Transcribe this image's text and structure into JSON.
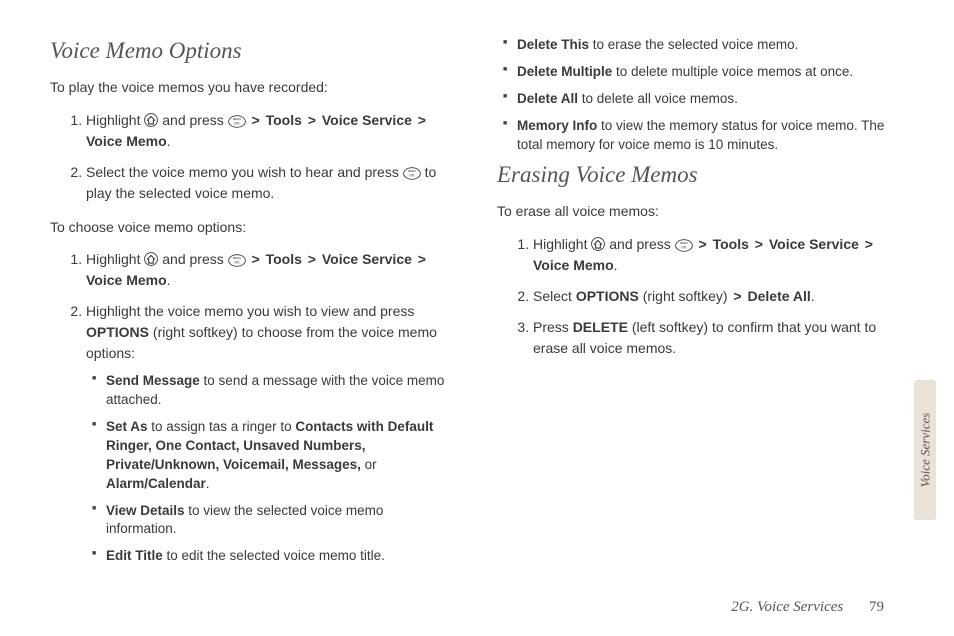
{
  "left": {
    "heading": "Voice Memo Options",
    "intro1": "To play the voice memos you have recorded:",
    "step1a_pre": "Highlight ",
    "step1a_mid": " and press ",
    "step1a_path": {
      "p1": "Tools",
      "p2": "Voice Service",
      "p3": "Voice Memo"
    },
    "step1b_pre": "Select the voice memo you wish to hear and press ",
    "step1b_post": " to play the selected voice memo.",
    "intro2": "To choose voice memo options:",
    "step2a_pre": "Highlight ",
    "step2a_mid": " and press ",
    "step2a_path": {
      "p1": "Tools",
      "p2": "Voice Service",
      "p3": "Voice Memo"
    },
    "step2b_pre": "Highlight the voice memo you wish to view and press ",
    "step2b_key": "OPTIONS",
    "step2b_post": " (right softkey) to choose from the voice memo options:",
    "opts": {
      "send_b": "Send Message",
      "send_t": " to send a message with the voice memo attached.",
      "setas_b": "Set As",
      "setas_mid": " to assign tas a ringer to ",
      "setas_list": "Contacts with Default Ringer, One Contact, Unsaved Numbers, Private/Unknown, Voicemail, Messages,",
      "setas_or": " or ",
      "setas_last": "Alarm/Calendar",
      "view_b": "View Details",
      "view_t": " to view the selected voice memo information.",
      "edit_b": "Edit Title",
      "edit_t": " to edit the selected voice memo title."
    }
  },
  "right": {
    "opts": {
      "delthis_b": "Delete This",
      "delthis_t": " to erase the selected voice memo.",
      "delmulti_b": "Delete Multiple",
      "delmulti_t": " to delete multiple voice memos at once.",
      "delall_b": "Delete All",
      "delall_t": " to delete all voice memos.",
      "mem_b": "Memory Info",
      "mem_t": " to view the memory status for voice memo. The total memory for voice memo is 10 minutes."
    },
    "heading": "Erasing Voice Memos",
    "intro": "To erase all voice memos:",
    "step1_pre": "Highlight ",
    "step1_mid": " and press ",
    "step1_path": {
      "p1": "Tools",
      "p2": "Voice Service",
      "p3": "Voice Memo"
    },
    "step2_pre": "Select ",
    "step2_key": "OPTIONS",
    "step2_mid": " (right softkey) ",
    "step2_last": "Delete All",
    "step3_pre": "Press ",
    "step3_key": "DELETE",
    "step3_post": " (left softkey) to confirm that you want to erase all voice memos."
  },
  "sidetab": "Voice Services",
  "footer_section": "2G. Voice Services",
  "footer_page": "79",
  "sep": ">"
}
